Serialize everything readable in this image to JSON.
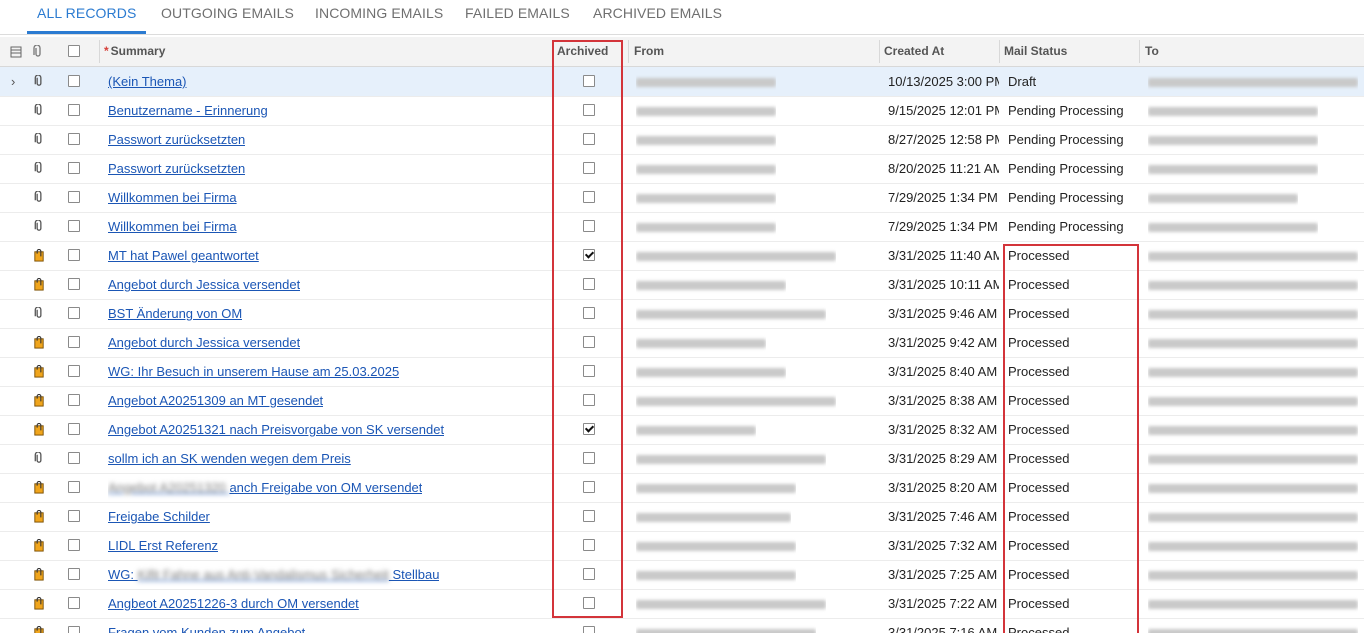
{
  "tabs": [
    {
      "label": "ALL RECORDS",
      "active": true
    },
    {
      "label": "OUTGOING EMAILS",
      "active": false
    },
    {
      "label": "INCOMING EMAILS",
      "active": false
    },
    {
      "label": "FAILED EMAILS",
      "active": false
    },
    {
      "label": "ARCHIVED EMAILS",
      "active": false
    }
  ],
  "columns": {
    "summary": "Summary",
    "archived": "Archived",
    "from": "From",
    "created_at": "Created At",
    "mail_status": "Mail Status",
    "to": "To"
  },
  "colors": {
    "accent": "#2b7bd1",
    "link": "#1b56b5",
    "highlight": "#d3343a"
  },
  "rows": [
    {
      "icon": "clip",
      "summary": "(Kein Thema)",
      "archived": false,
      "created_at": "10/13/2025 3:00 PM",
      "status": "Draft",
      "selected": true
    },
    {
      "icon": "clip",
      "summary": "Benutzername - Erinnerung",
      "archived": false,
      "created_at": "9/15/2025 12:01 PM",
      "status": "Pending Processing"
    },
    {
      "icon": "clip",
      "summary": "Passwort zurücksetzten",
      "archived": false,
      "created_at": "8/27/2025 12:58 PM",
      "status": "Pending Processing"
    },
    {
      "icon": "clip",
      "summary": "Passwort zurücksetzten",
      "archived": false,
      "created_at": "8/20/2025 11:21 AM",
      "status": "Pending Processing"
    },
    {
      "icon": "clip",
      "summary": "Willkommen bei Firma",
      "archived": false,
      "created_at": "7/29/2025 1:34 PM",
      "status": "Pending Processing"
    },
    {
      "icon": "clip",
      "summary": "Willkommen bei Firma",
      "archived": false,
      "created_at": "7/29/2025 1:34 PM",
      "status": "Pending Processing"
    },
    {
      "icon": "attach",
      "summary": "MT hat Pawel geantwortet",
      "archived": true,
      "created_at": "3/31/2025 11:40 AM",
      "status": "Processed"
    },
    {
      "icon": "attach",
      "summary": "Angebot durch Jessica versendet",
      "archived": false,
      "created_at": "3/31/2025 10:11 AM",
      "status": "Processed"
    },
    {
      "icon": "clip",
      "summary": "BST Änderung von OM",
      "archived": false,
      "created_at": "3/31/2025 9:46 AM",
      "status": "Processed"
    },
    {
      "icon": "attach",
      "summary": "Angebot durch Jessica versendet",
      "archived": false,
      "created_at": "3/31/2025 9:42 AM",
      "status": "Processed"
    },
    {
      "icon": "attach",
      "summary": "WG: Ihr Besuch in unserem Hause am 25.03.2025",
      "archived": false,
      "created_at": "3/31/2025 8:40 AM",
      "status": "Processed"
    },
    {
      "icon": "attach",
      "summary": "Angebot A20251309 an MT gesendet",
      "archived": false,
      "created_at": "3/31/2025 8:38 AM",
      "status": "Processed"
    },
    {
      "icon": "attach",
      "summary": "Angebot A20251321 nach Preisvorgabe von SK versendet",
      "archived": true,
      "created_at": "3/31/2025 8:32 AM",
      "status": "Processed"
    },
    {
      "icon": "clip",
      "summary": "sollm ich an SK wenden wegen dem Preis",
      "archived": false,
      "created_at": "3/31/2025 8:29 AM",
      "status": "Processed"
    },
    {
      "icon": "attach",
      "summary": "anch Freigabe von OM versendet",
      "blur_prefix": true,
      "archived": false,
      "created_at": "3/31/2025 8:20 AM",
      "status": "Processed"
    },
    {
      "icon": "attach",
      "summary": "Freigabe Schilder",
      "archived": false,
      "created_at": "3/31/2025 7:46 AM",
      "status": "Processed"
    },
    {
      "icon": "attach",
      "summary": "LIDL Erst Referenz",
      "archived": false,
      "created_at": "3/31/2025 7:32 AM",
      "status": "Processed"
    },
    {
      "icon": "attach",
      "summary": "WG: ",
      "blur_suffix": "bau",
      "archived": false,
      "created_at": "3/31/2025 7:25 AM",
      "status": "Processed"
    },
    {
      "icon": "attach",
      "summary": "Angbeot A20251226-3 durch OM versendet",
      "archived": false,
      "created_at": "3/31/2025 7:22 AM",
      "status": "Processed"
    },
    {
      "icon": "attach",
      "summary": "Fragen vom  Kunden zum Angebot",
      "archived": false,
      "created_at": "3/31/2025 7:16 AM",
      "status": "Processed"
    }
  ]
}
